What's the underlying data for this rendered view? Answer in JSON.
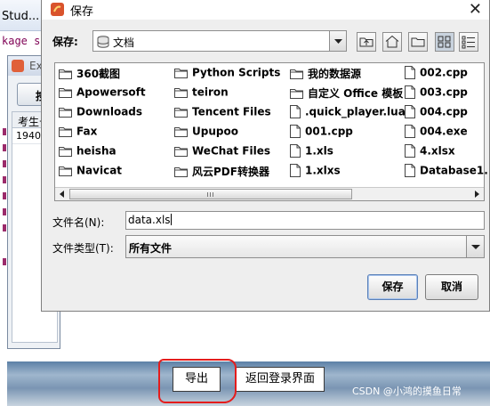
{
  "background": {
    "ide_title": "Stud...",
    "code_snippet": "kage s",
    "window_title": "Ex",
    "window_button": "按",
    "table_header": "考生号",
    "table_cell": "1940..."
  },
  "dialog": {
    "title": "保存",
    "save_in_label": "保存:",
    "save_in_value": "文档",
    "toolbar": [
      "up-folder",
      "home",
      "new-folder",
      "list-view",
      "details-view"
    ],
    "files": [
      {
        "name": "360截图",
        "type": "folder"
      },
      {
        "name": "Apowersoft",
        "type": "folder"
      },
      {
        "name": "Downloads",
        "type": "folder"
      },
      {
        "name": "Fax",
        "type": "folder"
      },
      {
        "name": "heisha",
        "type": "folder"
      },
      {
        "name": "Navicat",
        "type": "folder"
      },
      {
        "name": "Python Scripts",
        "type": "folder"
      },
      {
        "name": "teiron",
        "type": "folder"
      },
      {
        "name": "Tencent Files",
        "type": "folder"
      },
      {
        "name": "Upupoo",
        "type": "folder"
      },
      {
        "name": "WeChat Files",
        "type": "folder"
      },
      {
        "name": "风云PDF转换器",
        "type": "folder"
      },
      {
        "name": "我的数据源",
        "type": "folder"
      },
      {
        "name": "自定义 Office 模板",
        "type": "folder"
      },
      {
        "name": ".quick_player.lua",
        "type": "file"
      },
      {
        "name": "001.cpp",
        "type": "file"
      },
      {
        "name": "1.xls",
        "type": "file"
      },
      {
        "name": "1.xlxs",
        "type": "file"
      },
      {
        "name": "002.cpp",
        "type": "file"
      },
      {
        "name": "003.cpp",
        "type": "file"
      },
      {
        "name": "004.cpp",
        "type": "file"
      },
      {
        "name": "004.exe",
        "type": "file"
      },
      {
        "name": "4.xlsx",
        "type": "file"
      },
      {
        "name": "Database1.",
        "type": "file"
      }
    ],
    "filename_label": "文件名(N):",
    "filename_value": "data.xls",
    "filetype_label": "文件类型(T):",
    "filetype_value": "所有文件",
    "save_button": "保存",
    "cancel_button": "取消"
  },
  "bottom": {
    "export_button": "导出",
    "back_button": "返回登录界面",
    "watermark": "CSDN @小鸿的摸鱼日常"
  },
  "colors": {
    "annotation": "#e41c1c",
    "folder": "#4a4a4a",
    "selection_accent": "#5a80b8"
  }
}
